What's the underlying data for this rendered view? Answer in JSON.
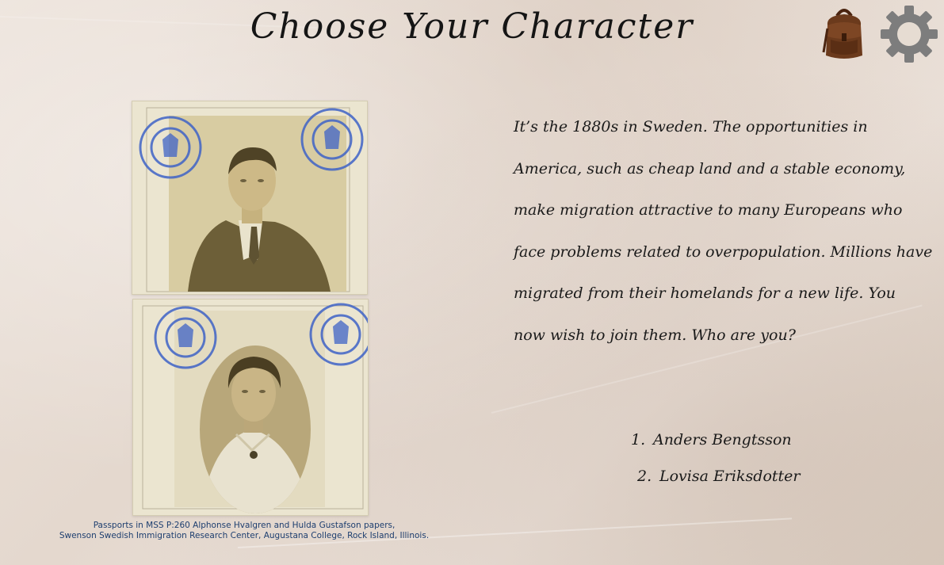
{
  "header": {
    "title": "Choose Your Character"
  },
  "toolbar": {
    "inventory_icon": "backpack-icon",
    "settings_icon": "gear-icon"
  },
  "colors": {
    "caption_text": "#1d3e6f",
    "stamp_ink": "#3f63c7",
    "photo_sepia": "#b8a77a",
    "gear_grey": "#7d7d7d",
    "backpack_brown": "#6b3a1c"
  },
  "photos": {
    "man": {
      "alt": "Passport photo of a man in a suit"
    },
    "woman": {
      "alt": "Passport photo of a woman in an oval frame"
    },
    "caption_lines": [
      "Passports in MSS P:260 Alphonse Hvalgren and Hulda Gustafson papers,",
      "Swenson Swedish Immigration Research Center, Augustana College, Rock Island, Illinois."
    ]
  },
  "story": {
    "lines": [
      "It’s the 1880s in Sweden. The opportunities in",
      "America, such as cheap land and a stable economy,",
      "make migration attractive to many Europeans who",
      " face problems related to overpopulation. Millions have",
      "migrated from their homelands for a new life. You",
      "now wish to join them. Who are you?"
    ]
  },
  "choices": [
    {
      "number": "1.",
      "label": "Anders Bengtsson"
    },
    {
      "number": "2.",
      "label": "Lovisa Eriksdotter"
    }
  ]
}
